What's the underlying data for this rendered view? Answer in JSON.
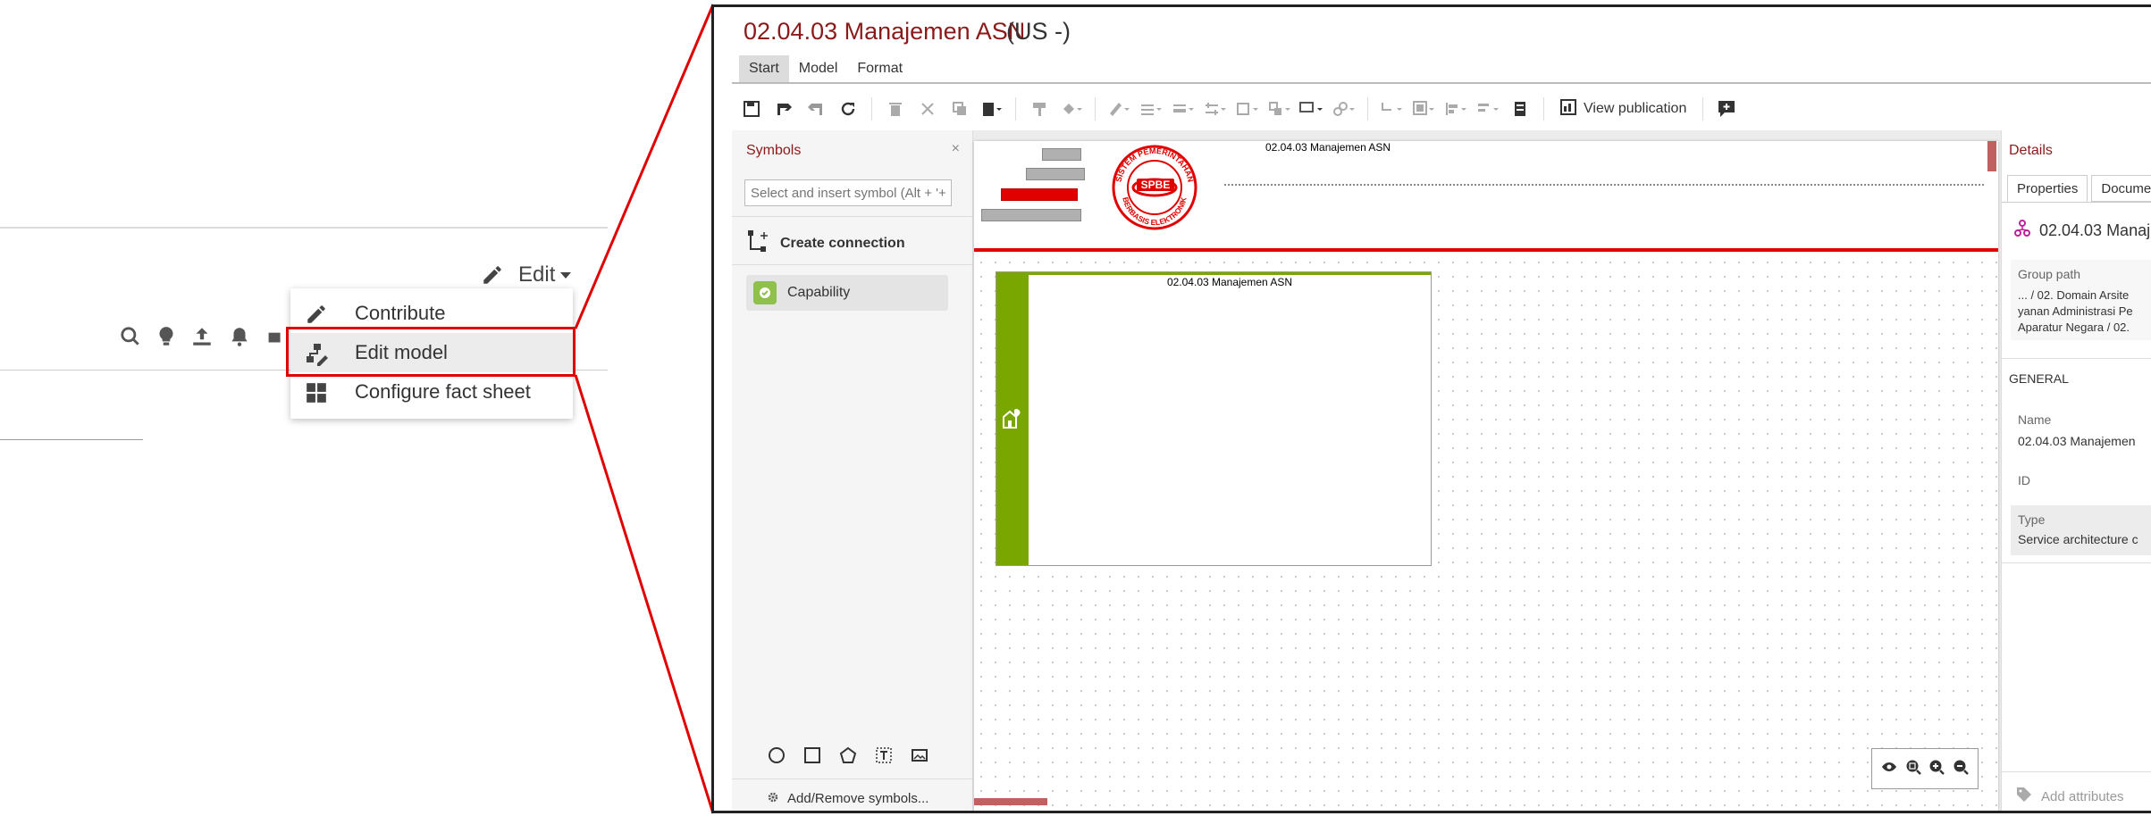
{
  "left": {
    "edit_label": "Edit",
    "menu": [
      {
        "label": "Contribute",
        "icon": "pencil-icon"
      },
      {
        "label": "Edit model",
        "icon": "edit-model-icon"
      },
      {
        "label": "Configure fact sheet",
        "icon": "grid-icon"
      }
    ],
    "toolbar_icons": [
      "search-icon",
      "lightbulb-icon",
      "upload-icon",
      "bell-icon",
      "plugin-icon"
    ]
  },
  "editor": {
    "title": "02.04.03 Manajemen ASN",
    "language": "(US -)",
    "tabs": [
      "Start",
      "Model",
      "Format"
    ],
    "active_tab": "Start",
    "view_publication": "View publication",
    "symbols": {
      "heading": "Symbols",
      "close": "×",
      "search_placeholder": "Select and insert symbol (Alt + '+')",
      "create_connection": "Create connection",
      "capability": "Capability",
      "add_remove": "Add/Remove symbols..."
    },
    "canvas": {
      "diagram_title": "02.04.03 Manajemen ASN",
      "logo_text": "SPBE",
      "logo_ring_top": "SISTEM PEMERINTAHAN",
      "logo_ring_bottom": "BERBASIS ELEKTRONIK",
      "capability_title": "02.04.03 Manajemen ASN"
    },
    "details": {
      "heading": "Details",
      "tabs": [
        "Properties",
        "Docume"
      ],
      "name_display": "02.04.03 Manaj",
      "group_path_label": "Group path",
      "group_path_lines": [
        "... / 02. Domain Arsite",
        "yanan Administrasi Pe",
        "Aparatur Negara / 02."
      ],
      "general_label": "GENERAL",
      "name_label": "Name",
      "name_value": "02.04.03 Manajemen",
      "id_label": "ID",
      "type_label": "Type",
      "type_value": "Service architecture c",
      "add_attributes": "Add attributes"
    }
  },
  "colors": {
    "accent": "#8b1a1a",
    "highlight": "#e00000",
    "capability_green": "#7aa600"
  }
}
